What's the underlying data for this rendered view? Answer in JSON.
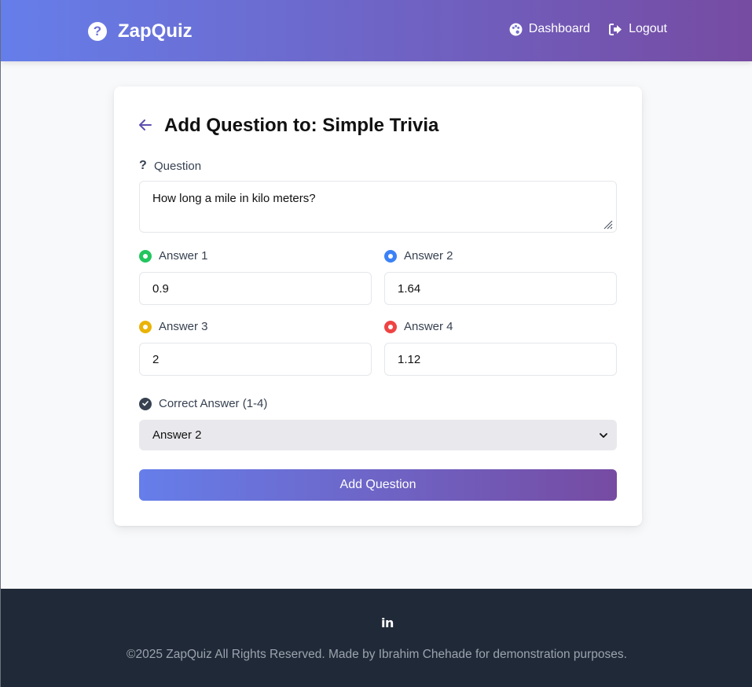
{
  "header": {
    "brand_icon": "question-circle-icon",
    "brand_name": "ZapQuiz",
    "nav": {
      "dashboard_label": "Dashboard",
      "dashboard_icon": "palette-icon",
      "logout_label": "Logout",
      "logout_icon": "sign-out-icon"
    }
  },
  "form": {
    "back_icon": "arrow-left-icon",
    "title": "Add Question to: Simple Trivia",
    "question_label": "Question",
    "question_value": "How long a mile in kilo meters?",
    "answers": [
      {
        "label": "Answer 1",
        "value": "0.9",
        "color": "#22c55e"
      },
      {
        "label": "Answer 2",
        "value": "1.64",
        "color": "#3b82f6"
      },
      {
        "label": "Answer 3",
        "value": "2",
        "color": "#eab308"
      },
      {
        "label": "Answer 4",
        "value": "1.12",
        "color": "#ef4444"
      }
    ],
    "correct_label": "Correct Answer (1-4)",
    "correct_selected": "Answer 2",
    "submit_label": "Add Question"
  },
  "footer": {
    "social_icon": "in",
    "copyright": "©2025 ZapQuiz All Rights Reserved. Made by Ibrahim Chehade for demonstration purposes."
  },
  "colors": {
    "gradient_start": "#667eea",
    "gradient_end": "#764ba2",
    "footer_bg": "#1f2937"
  }
}
